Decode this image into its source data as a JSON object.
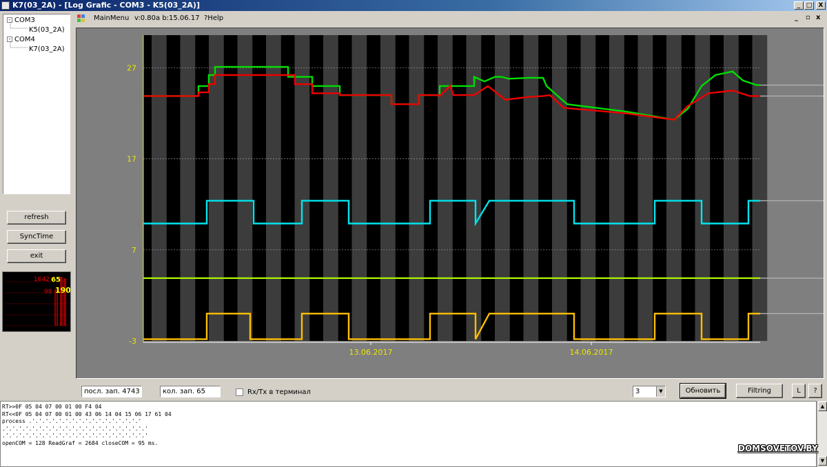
{
  "window": {
    "title": "K7(03_2A) - [Log Grafic - COM3 - K5(03_2A)]",
    "controls": [
      "_",
      "□",
      "X"
    ],
    "child_controls": [
      "_",
      "▫",
      "x"
    ]
  },
  "tree": {
    "items": [
      {
        "label": "COM3",
        "expander": "-"
      },
      {
        "label": "K5(03_2A)"
      },
      {
        "label": "COM4",
        "expander": "-"
      },
      {
        "label": "K7(03_2A)"
      }
    ]
  },
  "side_buttons": {
    "refresh": "refresh",
    "sync": "SyncTime",
    "exit": "exit"
  },
  "mini_chart": {
    "values": [
      "1642",
      "65",
      "98",
      "190"
    ]
  },
  "menu": {
    "main": "MainMenu",
    "version": "v:0.80a b:15.06.17",
    "help": "?Help"
  },
  "chart_data": {
    "type": "line",
    "ylim": [
      -3,
      31
    ],
    "yticks": [
      "27",
      "17",
      "7",
      "-3"
    ],
    "xticks": [
      "13.06.2017",
      "14.06.2017"
    ],
    "series": [
      {
        "color": "#00dd00",
        "points": [
          [
            0,
            23.9
          ],
          [
            80,
            23.9
          ],
          [
            80,
            25
          ],
          [
            95,
            25
          ],
          [
            95,
            26.2
          ],
          [
            104,
            26.2
          ],
          [
            104,
            27.1
          ],
          [
            210,
            27.1
          ],
          [
            210,
            26
          ],
          [
            245,
            26
          ],
          [
            245,
            25
          ],
          [
            285,
            25
          ],
          [
            285,
            24
          ],
          [
            360,
            24
          ],
          [
            360,
            23
          ],
          [
            400,
            23
          ],
          [
            400,
            24
          ],
          [
            430,
            24
          ],
          [
            430,
            25
          ],
          [
            480,
            25
          ],
          [
            480,
            26
          ],
          [
            495,
            25.5
          ],
          [
            510,
            26
          ],
          [
            520,
            26
          ],
          [
            530,
            25.8
          ],
          [
            560,
            25.9
          ],
          [
            580,
            25.9
          ],
          [
            585,
            25
          ],
          [
            600,
            24
          ],
          [
            615,
            23
          ],
          [
            700,
            22.2
          ],
          [
            770,
            21.3
          ],
          [
            790,
            22.5
          ],
          [
            810,
            25
          ],
          [
            830,
            26.2
          ],
          [
            855,
            26.6
          ],
          [
            870,
            25.6
          ],
          [
            890,
            25.1
          ],
          [
            895,
            25.1
          ]
        ]
      },
      {
        "color": "#ee0000",
        "points": [
          [
            0,
            23.9
          ],
          [
            80,
            23.9
          ],
          [
            80,
            24.3
          ],
          [
            95,
            24.3
          ],
          [
            95,
            25.2
          ],
          [
            104,
            25.2
          ],
          [
            104,
            26.2
          ],
          [
            220,
            26.2
          ],
          [
            220,
            25.2
          ],
          [
            245,
            25.2
          ],
          [
            245,
            24.2
          ],
          [
            285,
            24.2
          ],
          [
            285,
            24
          ],
          [
            360,
            24
          ],
          [
            360,
            23
          ],
          [
            400,
            23
          ],
          [
            400,
            24
          ],
          [
            430,
            24
          ],
          [
            430,
            23.9
          ],
          [
            445,
            25
          ],
          [
            450,
            24
          ],
          [
            480,
            24
          ],
          [
            500,
            25
          ],
          [
            525,
            23.5
          ],
          [
            560,
            23.8
          ],
          [
            580,
            23.9
          ],
          [
            590,
            24
          ],
          [
            610,
            22.6
          ],
          [
            700,
            22
          ],
          [
            770,
            21.3
          ],
          [
            790,
            22.8
          ],
          [
            820,
            24.2
          ],
          [
            855,
            24.5
          ],
          [
            880,
            23.9
          ],
          [
            895,
            23.9
          ]
        ]
      },
      {
        "color": "#00e5ee",
        "points": [
          [
            0,
            9.9
          ],
          [
            92,
            9.9
          ],
          [
            92,
            12.4
          ],
          [
            160,
            12.4
          ],
          [
            160,
            9.9
          ],
          [
            230,
            9.9
          ],
          [
            230,
            12.4
          ],
          [
            298,
            12.4
          ],
          [
            298,
            9.9
          ],
          [
            416,
            9.9
          ],
          [
            416,
            12.4
          ],
          [
            482,
            12.4
          ],
          [
            482,
            9.9
          ],
          [
            502,
            12.4
          ],
          [
            510,
            12.4
          ],
          [
            625,
            12.4
          ],
          [
            625,
            9.9
          ],
          [
            742,
            9.9
          ],
          [
            742,
            12.4
          ],
          [
            810,
            12.4
          ],
          [
            810,
            9.9
          ],
          [
            878,
            9.9
          ],
          [
            878,
            12.4
          ],
          [
            895,
            12.4
          ]
        ]
      },
      {
        "color": "#a8ec00",
        "points": [
          [
            0,
            3.9
          ],
          [
            895,
            3.9
          ]
        ]
      },
      {
        "color": "#ffc000",
        "points": [
          [
            0,
            -2.8
          ],
          [
            92,
            -2.8
          ],
          [
            92,
            0
          ],
          [
            155,
            0
          ],
          [
            155,
            -2.8
          ],
          [
            230,
            -2.8
          ],
          [
            230,
            0
          ],
          [
            298,
            0
          ],
          [
            298,
            -2.8
          ],
          [
            416,
            -2.8
          ],
          [
            416,
            0
          ],
          [
            482,
            0
          ],
          [
            482,
            -2.8
          ],
          [
            502,
            0
          ],
          [
            510,
            0
          ],
          [
            625,
            0
          ],
          [
            625,
            -2.8
          ],
          [
            742,
            -2.8
          ],
          [
            742,
            0
          ],
          [
            810,
            0
          ],
          [
            810,
            -2.8
          ],
          [
            878,
            -2.8
          ],
          [
            878,
            0
          ],
          [
            895,
            0
          ]
        ]
      }
    ]
  },
  "bottom": {
    "last_record": "посл. зап. 4743",
    "record_count": "кол. зап. 65",
    "rxtx_label": "Rx/Tx в терминал",
    "combo_value": "3",
    "refresh": "Обновить",
    "filtering": "Filtring",
    "l_button": "L",
    "help_button": "?"
  },
  "terminal": {
    "lines": [
      "RT>>0F 05 04 07 00 01 00 F4 04",
      "RT<<0F 05 04 07 00 01 00 43 06 14 04 15 06 17 61 04",
      "process .'.'.'.'.'.'.'.'.'.'.'.'.'.'.'.'.'",
      ".'.'.'.'.'.'.'.'.'.'.'.'.'.'.'.'.'.'.'.'.'.'",
      ".'.'.'.'.'.'.'.'.'.'.'.'.'.'.'.'.'.'.'.'.'.'",
      "openCOM = 128 ReadGraf = 2684 closeCOM = 95 ms."
    ]
  },
  "watermark": "DOMSOVETOV.BY"
}
